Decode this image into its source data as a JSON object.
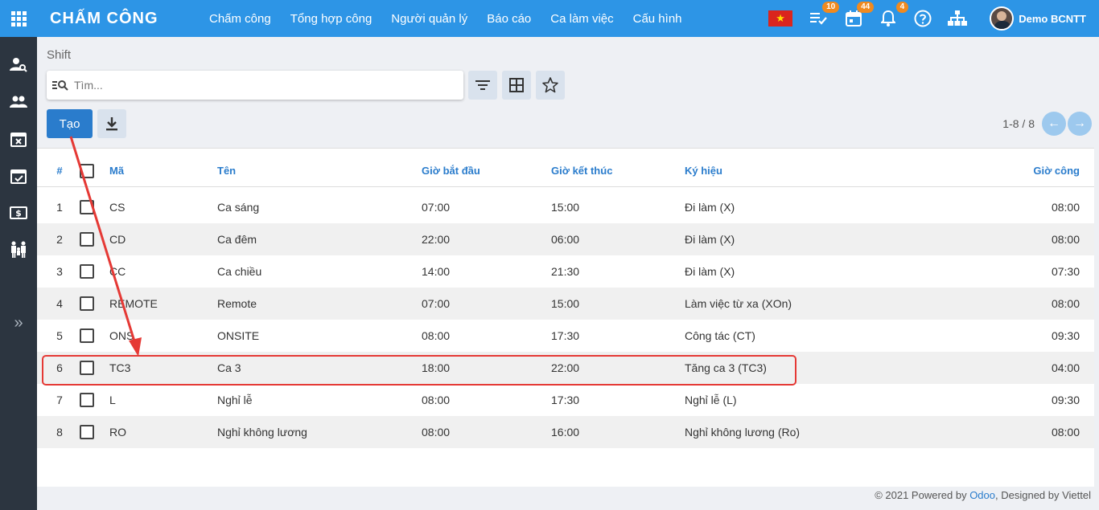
{
  "app": {
    "title": "CHẤM CÔNG"
  },
  "menu": [
    "Chấm công",
    "Tổng hợp công",
    "Người quản lý",
    "Báo cáo",
    "Ca làm việc",
    "Cấu hình"
  ],
  "topbar": {
    "activities_count": "10",
    "calendar_count": "44",
    "notifications_count": "4",
    "user_name": "Demo BCNTT"
  },
  "breadcrumb": "Shift",
  "search": {
    "placeholder": "Tìm..."
  },
  "actions": {
    "create_label": "Tạo"
  },
  "pager": {
    "text": "1-8 / 8"
  },
  "table": {
    "headers": {
      "num": "#",
      "code": "Mã",
      "name": "Tên",
      "start": "Giờ bắt đầu",
      "end": "Giờ kết thúc",
      "symbol": "Ký hiệu",
      "hours": "Giờ công"
    },
    "rows": [
      {
        "num": "1",
        "code": "CS",
        "name": "Ca sáng",
        "start": "07:00",
        "end": "15:00",
        "symbol": "Đi làm (X)",
        "hours": "08:00"
      },
      {
        "num": "2",
        "code": "CD",
        "name": "Ca đêm",
        "start": "22:00",
        "end": "06:00",
        "symbol": "Đi làm (X)",
        "hours": "08:00"
      },
      {
        "num": "3",
        "code": "CC",
        "name": "Ca chiều",
        "start": "14:00",
        "end": "21:30",
        "symbol": "Đi làm (X)",
        "hours": "07:30"
      },
      {
        "num": "4",
        "code": "REMOTE",
        "name": "Remote",
        "start": "07:00",
        "end": "15:00",
        "symbol": "Làm việc từ xa (XOn)",
        "hours": "08:00"
      },
      {
        "num": "5",
        "code": "ONS",
        "name": "ONSITE",
        "start": "08:00",
        "end": "17:30",
        "symbol": "Công tác (CT)",
        "hours": "09:30"
      },
      {
        "num": "6",
        "code": "TC3",
        "name": "Ca 3",
        "start": "18:00",
        "end": "22:00",
        "symbol": "Tăng ca 3 (TC3)",
        "hours": "04:00"
      },
      {
        "num": "7",
        "code": "L",
        "name": "Nghỉ lễ",
        "start": "08:00",
        "end": "17:30",
        "symbol": "Nghỉ lễ (L)",
        "hours": "09:30"
      },
      {
        "num": "8",
        "code": "RO",
        "name": "Nghỉ không lương",
        "start": "08:00",
        "end": "16:00",
        "symbol": "Nghỉ không lương (Ro)",
        "hours": "08:00"
      }
    ]
  },
  "footer": {
    "prefix": "© 2021 Powered by ",
    "odoo": "Odoo",
    "suffix": ", Designed by Viettel"
  },
  "colors": {
    "topbar": "#2d95e6",
    "sidebar": "#2c3540",
    "primary": "#2a7ccc",
    "badge": "#f08a1f",
    "annotation": "#e53935"
  }
}
